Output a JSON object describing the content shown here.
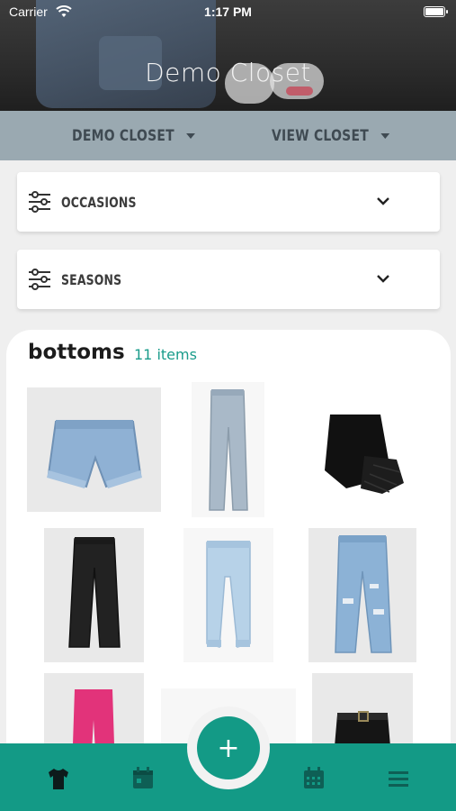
{
  "status_bar": {
    "carrier": "Carrier",
    "time": "1:17 PM"
  },
  "header": {
    "title": "Demo Closet"
  },
  "nav": {
    "closet_select": "DEMO CLOSET",
    "view_select": "VIEW CLOSET"
  },
  "filters": [
    {
      "label": "OCCASIONS",
      "icon": "sliders-icon"
    },
    {
      "label": "SEASONS",
      "icon": "sliders-icon"
    }
  ],
  "category": {
    "title": "bottoms",
    "count": "11 items"
  },
  "items": [
    {
      "name": "denim-shorts"
    },
    {
      "name": "light-wash-jeans"
    },
    {
      "name": "black-feather-skirt"
    },
    {
      "name": "black-wide-trousers"
    },
    {
      "name": "light-blue-joggers"
    },
    {
      "name": "ripped-jeans"
    },
    {
      "name": "pink-trousers"
    },
    {
      "name": "pink-item"
    },
    {
      "name": "black-belted-skirt"
    }
  ],
  "tabbar": {
    "tabs": [
      {
        "icon": "tshirt-icon",
        "active": true
      },
      {
        "icon": "calendar-icon",
        "active": false
      },
      {
        "icon": "calendar-grid-icon",
        "active": false
      },
      {
        "icon": "menu-icon",
        "active": false
      }
    ],
    "fab_label": "+"
  },
  "colors": {
    "accent": "#139a86",
    "navbar": "#9aa9b1",
    "count_text": "#1a9c8b"
  }
}
